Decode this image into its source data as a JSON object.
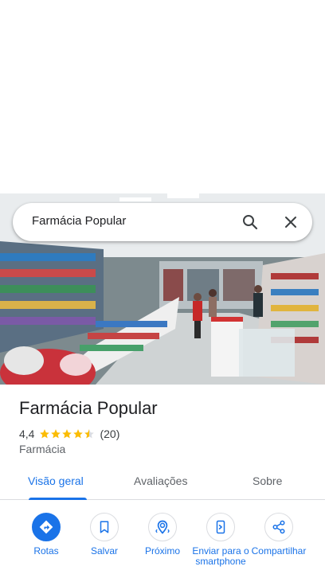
{
  "search": {
    "query": "Farmácia Popular",
    "search_icon": "search-icon",
    "close_icon": "close-icon"
  },
  "photo": {
    "description_icon": "store-photo"
  },
  "place": {
    "name": "Farmácia Popular",
    "rating": "4,4",
    "stars": 4.5,
    "review_count": "(20)",
    "category": "Farmácia"
  },
  "tabs": [
    {
      "label": "Visão geral",
      "active": true
    },
    {
      "label": "Avaliações",
      "active": false
    },
    {
      "label": "Sobre",
      "active": false
    }
  ],
  "actions": [
    {
      "label": "Rotas",
      "icon": "directions-icon"
    },
    {
      "label": "Salvar",
      "icon": "bookmark-icon"
    },
    {
      "label": "Próximo",
      "icon": "nearby-icon"
    },
    {
      "label": "Enviar para o smartphone",
      "icon": "send-to-phone-icon"
    },
    {
      "label": "Compartilhar",
      "icon": "share-icon"
    }
  ],
  "colors": {
    "accent": "#1a73e8",
    "star": "#fbbc04",
    "text": "#202124",
    "muted": "#5f6368"
  }
}
